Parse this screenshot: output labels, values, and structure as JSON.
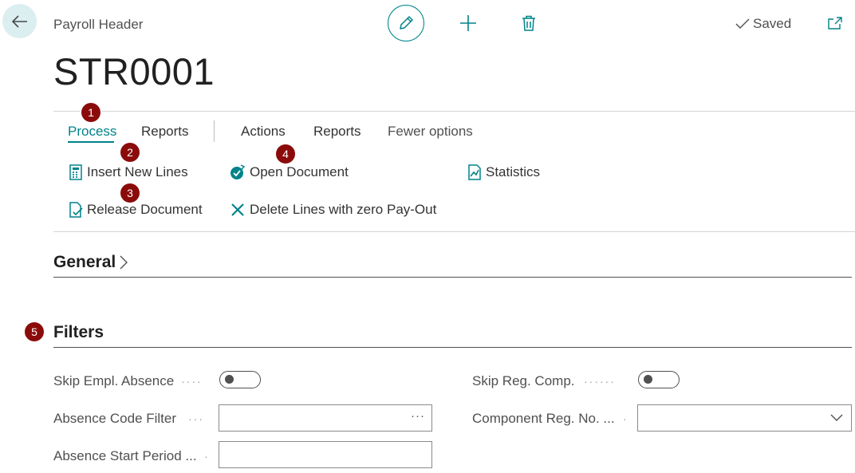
{
  "header": {
    "title": "Payroll Header",
    "record": "STR0001",
    "saved_label": "Saved",
    "icons": [
      "back-arrow-icon",
      "pencil-icon",
      "plus-icon",
      "trash-icon",
      "checkmark-icon",
      "popout-icon"
    ]
  },
  "tabs": [
    {
      "label": "Process",
      "active": true
    },
    {
      "label": "Reports",
      "active": false
    },
    {
      "label": "Actions",
      "active": false
    },
    {
      "label": "Reports",
      "active": false
    },
    {
      "label": "Fewer options",
      "active": false
    }
  ],
  "actions": [
    {
      "label": "Insert New Lines",
      "icon": "calculator-icon"
    },
    {
      "label": "Open Document",
      "icon": "reopen-icon"
    },
    {
      "label": "Statistics",
      "icon": "statistics-icon"
    },
    {
      "label": "Release Document",
      "icon": "release-document-icon"
    },
    {
      "label": "Delete Lines with zero Pay-Out",
      "icon": "delete-x-icon"
    }
  ],
  "badges": [
    "1",
    "2",
    "3",
    "4",
    "5"
  ],
  "sections": {
    "general": "General",
    "filters": "Filters"
  },
  "fields": {
    "skip_empl_absence": {
      "label": "Skip Empl. Absence",
      "value": false
    },
    "absence_code_filter": {
      "label": "Absence Code Filter",
      "value": ""
    },
    "absence_start_period": {
      "label": "Absence Start Period ...",
      "value": ""
    },
    "skip_reg_comp": {
      "label": "Skip Reg. Comp.",
      "value": false
    },
    "component_reg_no": {
      "label": "Component Reg. No. ...",
      "value": ""
    }
  },
  "colors": {
    "accent": "#00838a",
    "badge": "#8b0b0b",
    "back_button_bg": "#dbeef0"
  }
}
